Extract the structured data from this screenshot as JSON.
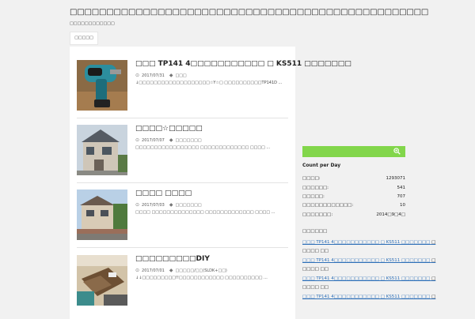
{
  "site": {
    "title": "□□□□□□□□□□□□□□□□□□□□□□□□□□□□□□□□□□□□□□□□□□□□□□□□□",
    "description": "□□□□□□□□□□□□",
    "nav": [
      "□□□□□"
    ]
  },
  "posts": [
    {
      "title": "□□□ TP141 4□□□□□□□□□□□ □ KS511 □□□□□□□",
      "date": "2017/07/31",
      "category": "□□□",
      "excerpt": "↓□□□□□□□□□□□□□□□□□□□☆Y☆□ □□□□□□□□□□TP141D ..."
    },
    {
      "title": "□□□□☆□□□□□",
      "date": "2017/07/07",
      "category": "□□□□□□□",
      "excerpt": "□□□□□□□□□□□□□□□□□ □□□□□□□□□□□□□ □□□□ ..."
    },
    {
      "title": "□□□□ □□□□",
      "date": "2017/07/03",
      "category": "□□□□□□□",
      "excerpt": "□□□□ □□□□□□□□□□□□□□ □□□□□□□□□□□□□ □□□□ ..."
    },
    {
      "title": "□□□□□□□□□DIY",
      "date": "2017/07/01",
      "category": "□□□□□/□□(SLDK+□□)",
      "excerpt": "↓↓□□□□□□□□□!!□□□□□□□□□□□□ □□□□□□□□□□ ..."
    }
  ],
  "sidebar": {
    "widget_title": "Count per Day",
    "stats": [
      {
        "label": "□□□□:",
        "value": "1293071"
      },
      {
        "label": "□□□□□□:",
        "value": "541"
      },
      {
        "label": "□□□□□:",
        "value": "707"
      },
      {
        "label": "□□□□□□□□□□□□:",
        "value": "10"
      },
      {
        "label": "□□□□□□□:",
        "value": "2014□9□4□"
      }
    ],
    "recent_title": "□□□□□□",
    "recent": [
      {
        "text": "□□□ TP141 4□□□□□□□□□□□ □ KS511 □□□□□□□",
        "suffix": "□",
        "link": true
      },
      {
        "text": "□□□□ □□",
        "suffix": "",
        "link": false
      },
      {
        "text": "□□□ TP141 4□□□□□□□□□□□ □ KS511 □□□□□□□",
        "suffix": "□",
        "link": true
      },
      {
        "text": "□□□□ □□",
        "suffix": "",
        "link": false
      },
      {
        "text": "□□□ TP141 4□□□□□□□□□□□ □ KS511 □□□□□□□",
        "suffix": "□",
        "link": true
      },
      {
        "text": "□□□□ □□",
        "suffix": "",
        "link": false
      },
      {
        "text": "□□□ TP141 4□□□□□□□□□□□ □ KS511 □□□□□□□",
        "suffix": "□",
        "link": true
      }
    ]
  },
  "icons": {
    "date": "clock-icon",
    "category": "tag-icon",
    "search": "search-icon"
  },
  "colors": {
    "accent": "#82d64b",
    "link": "#2d6fb8",
    "background": "#f1f1f1"
  }
}
